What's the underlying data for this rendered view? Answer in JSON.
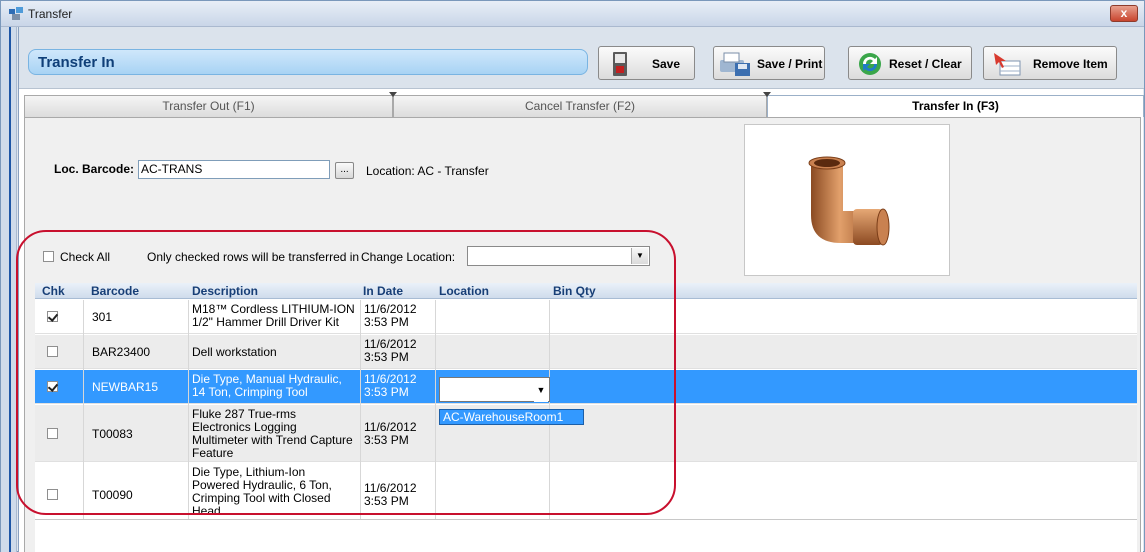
{
  "window": {
    "title": "Transfer",
    "close_label": "x"
  },
  "header": {
    "title": "Transfer In"
  },
  "toolbar": {
    "save_label": "Save",
    "save_print_label": "Save / Print",
    "reset_label": "Reset / Clear",
    "remove_label": "Remove Item"
  },
  "tabs": [
    {
      "label": "Transfer Out (F1)",
      "active": false
    },
    {
      "label": "Cancel Transfer (F2)",
      "active": false
    },
    {
      "label": "Transfer In (F3)",
      "active": true
    }
  ],
  "location": {
    "barcode_label": "Loc. Barcode:",
    "barcode_value": "AC-TRANS",
    "browse_label": "...",
    "location_text": "Location:  AC - Transfer"
  },
  "check_all": {
    "label": "Check All",
    "note": "Only checked rows will be transferred in",
    "change_location_label": "Change Location:",
    "change_location_value": ""
  },
  "grid": {
    "columns": [
      "Chk",
      "Barcode",
      "Description",
      "In Date",
      "Location",
      "Bin Qty"
    ],
    "rows": [
      {
        "checked": true,
        "barcode": "301",
        "description": [
          "M18™ Cordless LITHIUM-ION",
          "1/2\" Hammer Drill Driver Kit"
        ],
        "date": [
          "11/6/2012",
          "3:53 PM"
        ],
        "location": "",
        "bin_qty": ""
      },
      {
        "checked": false,
        "barcode": "BAR23400",
        "description": [
          "Dell workstation"
        ],
        "date": [
          "11/6/2012",
          "3:53 PM"
        ],
        "location": "",
        "bin_qty": ""
      },
      {
        "checked": true,
        "barcode": "NEWBAR15",
        "description": [
          "Die Type, Manual Hydraulic,",
          "14 Ton, Crimping Tool"
        ],
        "date": [
          "11/6/2012",
          "3:53 PM"
        ],
        "location": "",
        "bin_qty": ""
      },
      {
        "checked": false,
        "barcode": "T00083",
        "description": [
          "Fluke 287 True-rms",
          "Electronics Logging",
          "Multimeter with Trend Capture",
          "Feature"
        ],
        "date": [
          "11/6/2012",
          "3:53 PM"
        ],
        "location": "",
        "bin_qty": ""
      },
      {
        "checked": false,
        "barcode": "T00090",
        "description": [
          "Die Type, Lithium-Ion",
          "Powered Hydraulic, 6 Ton,",
          "Crimping Tool with Closed",
          "Head"
        ],
        "date": [
          "11/6/2012",
          "3:53 PM"
        ],
        "location": "",
        "bin_qty": ""
      }
    ],
    "dropdown_option": "AC-WarehouseRoom1"
  },
  "colors": {
    "selection": "#3399ff",
    "highlight": "#c8102e",
    "header_text": "#173e76"
  }
}
